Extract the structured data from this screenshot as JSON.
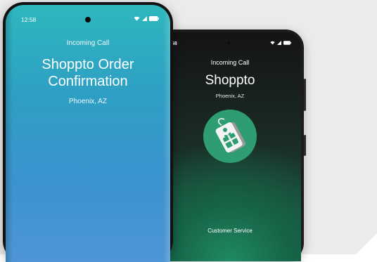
{
  "front_phone": {
    "status_time": "12:58",
    "incoming_label": "Incoming Call",
    "caller_name_line1": "Shoppto Order",
    "caller_name_line2": "Confirmation",
    "location": "Phoenix, AZ"
  },
  "back_phone": {
    "status_time": "58",
    "incoming_label": "Incoming Call",
    "caller_name": "Shoppto",
    "location": "Phoenix, AZ",
    "department": "Customer Service"
  },
  "icons": {
    "wifi": "wifi-icon",
    "signal": "signal-icon",
    "battery": "battery-icon",
    "logo": "shopping-tag-logo-icon"
  },
  "colors": {
    "front_screen": "#2ea8c4",
    "back_screen": "#1b5b43",
    "logo_circle": "#2e9d72"
  }
}
